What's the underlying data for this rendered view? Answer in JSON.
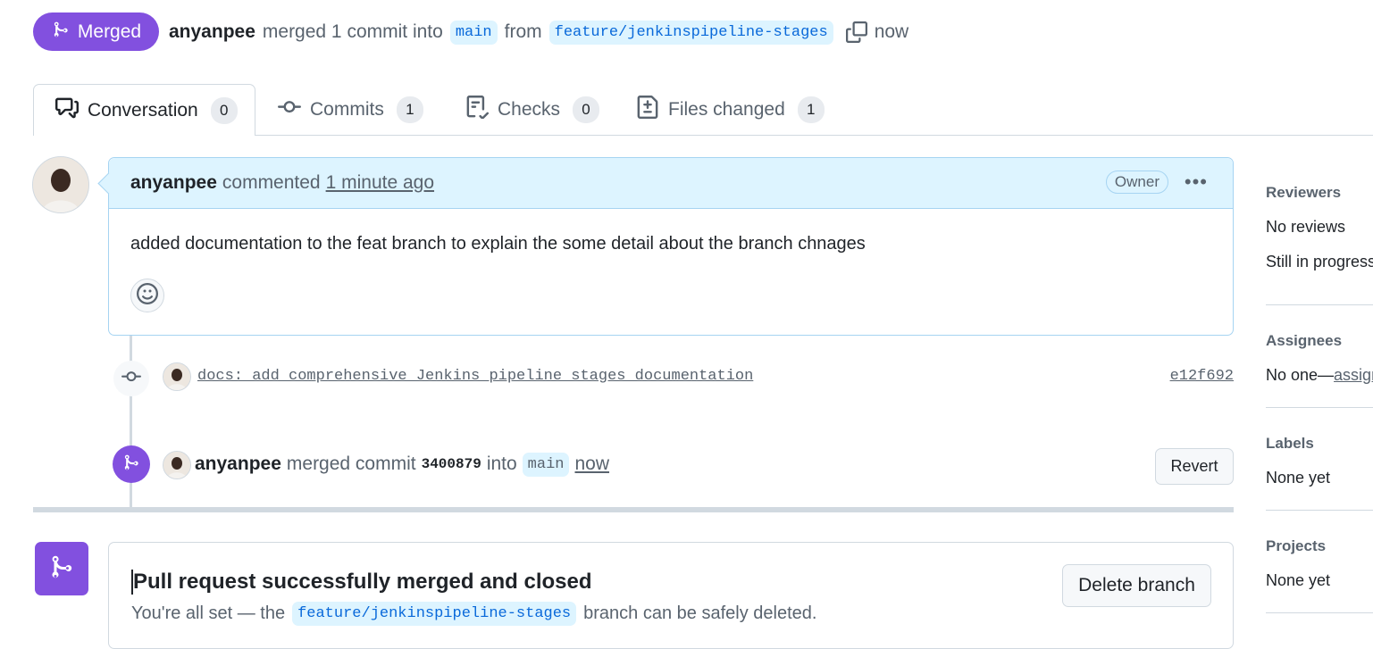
{
  "header": {
    "state_label": "Merged",
    "author": "anyanpee",
    "action_text": "merged 1 commit into",
    "base_branch": "main",
    "from_text": "from",
    "head_branch": "feature/jenkinspipeline-stages",
    "time": "now"
  },
  "tabs": [
    {
      "label": "Conversation",
      "count": "0"
    },
    {
      "label": "Commits",
      "count": "1"
    },
    {
      "label": "Checks",
      "count": "0"
    },
    {
      "label": "Files changed",
      "count": "1"
    }
  ],
  "comment": {
    "author": "anyanpee",
    "verb": "commented",
    "time_ago": "1 minute ago",
    "role_badge": "Owner",
    "body": "added documentation to the feat branch to explain the some detail about the branch chnages"
  },
  "commit": {
    "message": "docs: add comprehensive Jenkins pipeline stages documentation",
    "sha": "e12f692"
  },
  "merge_event": {
    "author": "anyanpee",
    "text": "merged commit",
    "sha": "3400879",
    "into_text": "into",
    "branch": "main",
    "time": "now",
    "revert_label": "Revert"
  },
  "merge_status": {
    "title": "Pull request successfully merged and closed",
    "sub_prefix": "You're all set — the",
    "branch": "feature/jenkinspipeline-stages",
    "sub_suffix": "branch can be safely deleted.",
    "delete_label": "Delete branch"
  },
  "sidebar": {
    "reviewers": {
      "heading": "Reviewers",
      "line1": "No reviews",
      "line2": "Still in progress"
    },
    "assignees": {
      "heading": "Assignees",
      "text": "No one—",
      "link": "assign"
    },
    "labels": {
      "heading": "Labels",
      "text": "None yet"
    },
    "projects": {
      "heading": "Projects",
      "text": "None yet"
    }
  },
  "colors": {
    "merged_purple": "#8250df",
    "branch_bg": "#ddf4ff",
    "branch_fg": "#0969da"
  }
}
